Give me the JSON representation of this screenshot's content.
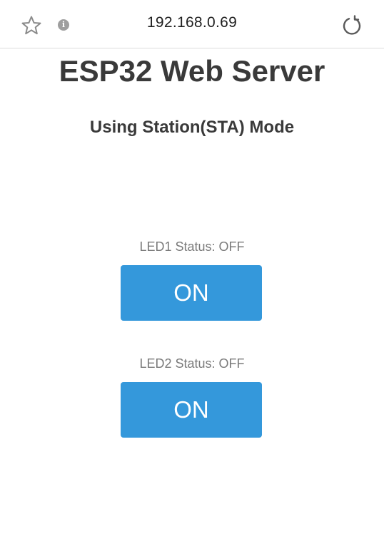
{
  "browser": {
    "url": "192.168.0.69",
    "icons": [
      "star-icon",
      "info-icon",
      "reload-icon"
    ]
  },
  "page": {
    "title": "ESP32 Web Server",
    "subtitle": "Using Station(STA) Mode",
    "leds": [
      {
        "status": "LED1 Status: OFF",
        "button_label": "ON"
      },
      {
        "status": "LED2 Status: OFF",
        "button_label": "ON"
      }
    ]
  },
  "colors": {
    "button": "#3498db",
    "title": "#3a3a3a",
    "status_text": "#7a7a7a"
  }
}
